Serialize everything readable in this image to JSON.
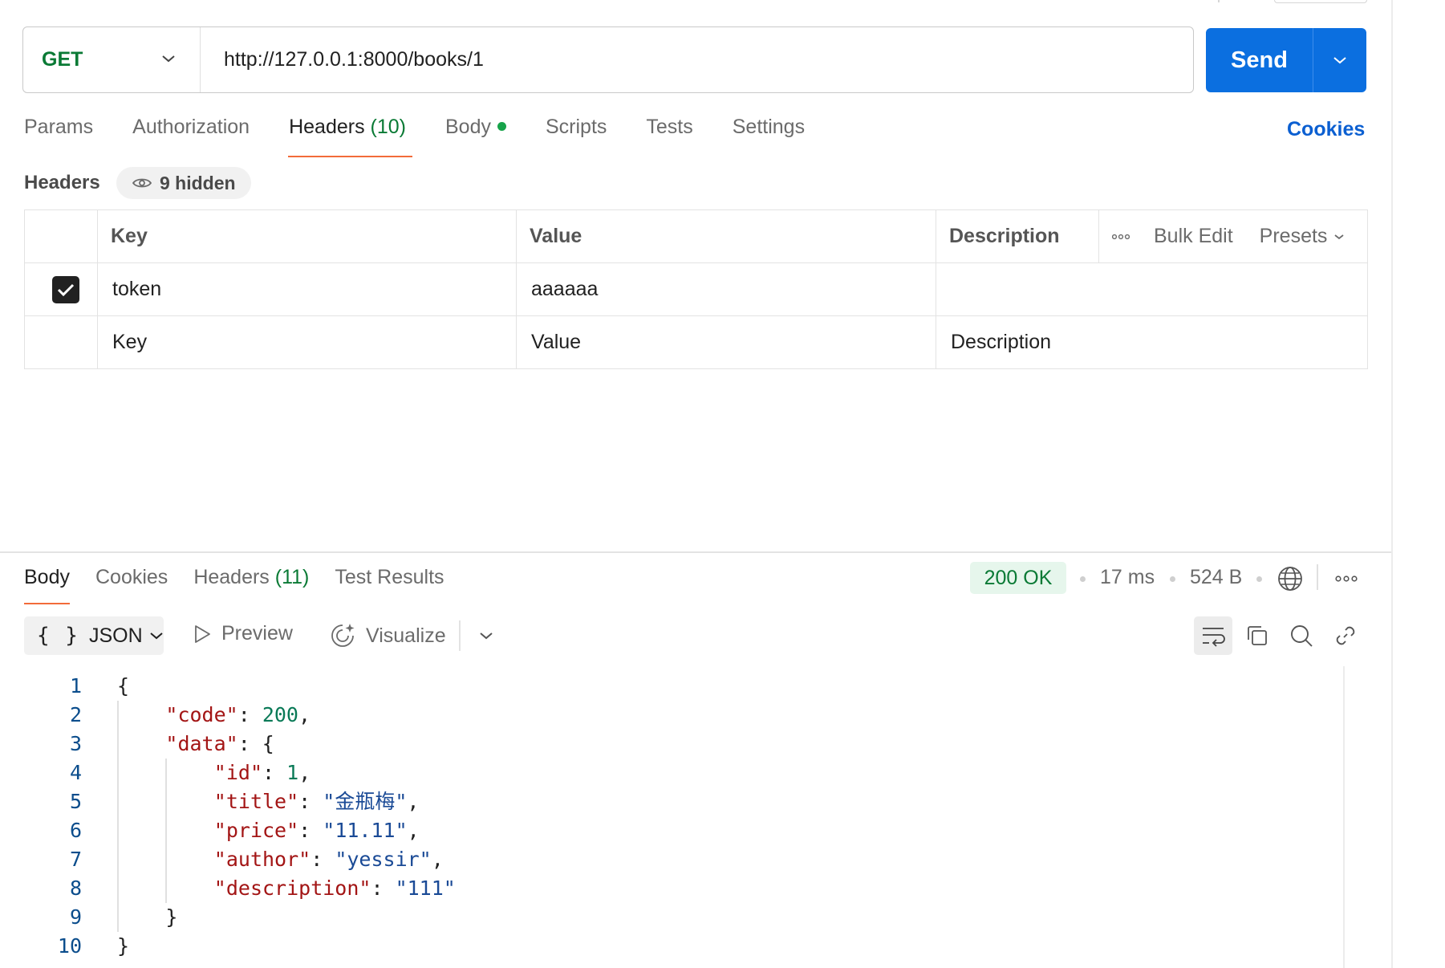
{
  "request": {
    "method": "GET",
    "url": "http://127.0.0.1:8000/books/1",
    "send_label": "Send"
  },
  "request_tabs": {
    "params": "Params",
    "authorization": "Authorization",
    "headers": "Headers",
    "headers_count": "(10)",
    "body": "Body",
    "scripts": "Scripts",
    "tests": "Tests",
    "settings": "Settings",
    "cookies": "Cookies"
  },
  "headers_section": {
    "title": "Headers",
    "hidden_label": "9 hidden",
    "columns": {
      "key": "Key",
      "value": "Value",
      "description": "Description"
    },
    "bulk_edit": "Bulk Edit",
    "presets": "Presets",
    "rows": [
      {
        "enabled": true,
        "key": "token",
        "value": "aaaaaa",
        "description": ""
      }
    ],
    "placeholders": {
      "key": "Key",
      "value": "Value",
      "description": "Description"
    }
  },
  "response_tabs": {
    "body": "Body",
    "cookies": "Cookies",
    "headers": "Headers",
    "headers_count": "(11)",
    "test_results": "Test Results"
  },
  "response_meta": {
    "status": "200 OK",
    "time": "17 ms",
    "size": "524 B"
  },
  "response_toolbar": {
    "format_braces": "{ }",
    "format": "JSON",
    "preview": "Preview",
    "visualize": "Visualize"
  },
  "code_lines": [
    {
      "num": "1",
      "parts": [
        {
          "t": "p",
          "v": "{"
        }
      ]
    },
    {
      "num": "2",
      "parts": [
        {
          "t": "k",
          "v": "\"code\""
        },
        {
          "t": "p",
          "v": ": "
        },
        {
          "t": "n",
          "v": "200"
        },
        {
          "t": "p",
          "v": ","
        }
      ]
    },
    {
      "num": "3",
      "parts": [
        {
          "t": "k",
          "v": "\"data\""
        },
        {
          "t": "p",
          "v": ": {"
        }
      ]
    },
    {
      "num": "4",
      "parts": [
        {
          "t": "k",
          "v": "\"id\""
        },
        {
          "t": "p",
          "v": ": "
        },
        {
          "t": "n",
          "v": "1"
        },
        {
          "t": "p",
          "v": ","
        }
      ]
    },
    {
      "num": "5",
      "parts": [
        {
          "t": "k",
          "v": "\"title\""
        },
        {
          "t": "p",
          "v": ": "
        },
        {
          "t": "s",
          "v": "\"金瓶梅\""
        },
        {
          "t": "p",
          "v": ","
        }
      ]
    },
    {
      "num": "6",
      "parts": [
        {
          "t": "k",
          "v": "\"price\""
        },
        {
          "t": "p",
          "v": ": "
        },
        {
          "t": "s",
          "v": "\"11.11\""
        },
        {
          "t": "p",
          "v": ","
        }
      ]
    },
    {
      "num": "7",
      "parts": [
        {
          "t": "k",
          "v": "\"author\""
        },
        {
          "t": "p",
          "v": ": "
        },
        {
          "t": "s",
          "v": "\"yessir\""
        },
        {
          "t": "p",
          "v": ","
        }
      ]
    },
    {
      "num": "8",
      "parts": [
        {
          "t": "k",
          "v": "\"description\""
        },
        {
          "t": "p",
          "v": ": "
        },
        {
          "t": "s",
          "v": "\"111\""
        }
      ]
    },
    {
      "num": "9",
      "parts": [
        {
          "t": "p",
          "v": "}"
        }
      ]
    },
    {
      "num": "10",
      "parts": [
        {
          "t": "p",
          "v": "}"
        }
      ]
    }
  ],
  "colors": {
    "accent_blue": "#0b6fe0",
    "method_green": "#0a7a35",
    "tab_underline": "#f26b3a",
    "status_bg": "#e6f6ec"
  }
}
